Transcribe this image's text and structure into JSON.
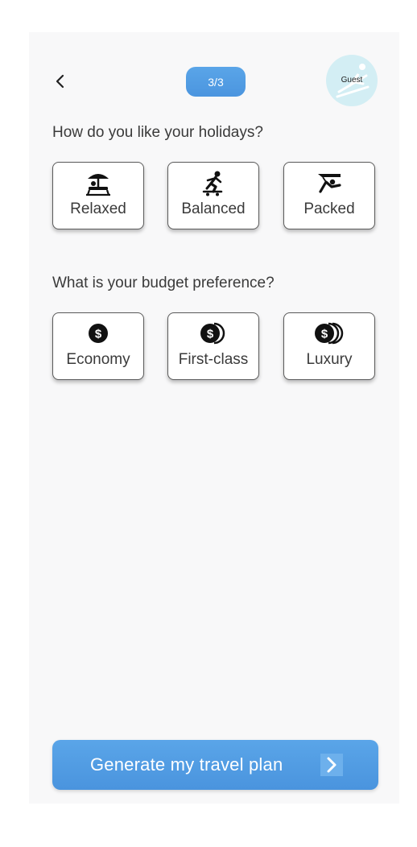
{
  "header": {
    "step": "3/3",
    "avatar_label": "Guest"
  },
  "holidays": {
    "question": "How do you like your holidays?",
    "options": [
      {
        "label": "Relaxed",
        "icon": "beach-umbrella-icon"
      },
      {
        "label": "Balanced",
        "icon": "skateboarder-icon"
      },
      {
        "label": "Packed",
        "icon": "hang-glider-icon"
      }
    ]
  },
  "budget": {
    "question": "What is your budget preference?",
    "options": [
      {
        "label": "Economy",
        "icon": "dollar-coin-icon"
      },
      {
        "label": "First-class",
        "icon": "dollar-coins-icon"
      },
      {
        "label": "Luxury",
        "icon": "dollar-coins-stack-icon"
      }
    ]
  },
  "footer": {
    "generate_label": "Generate my travel plan"
  },
  "colors": {
    "accent": "#4b95df",
    "avatar_bg": "#d3eef4",
    "background": "#f8f8f9"
  }
}
